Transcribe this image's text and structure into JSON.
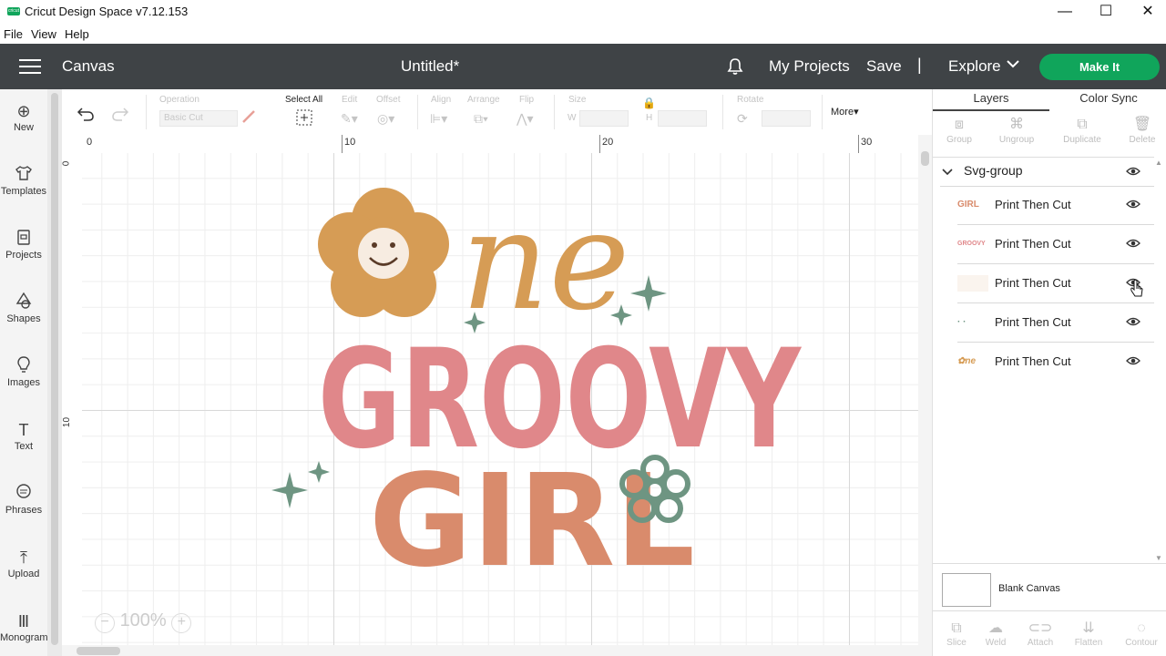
{
  "window": {
    "title": "Cricut Design Space  v7.12.153",
    "logo_text": "cricut",
    "minimize_glyph": "—",
    "maximize_glyph": "☐",
    "close_glyph": "✕"
  },
  "menubar": {
    "items": [
      "File",
      "View",
      "Help"
    ]
  },
  "header": {
    "section": "Canvas",
    "doc_title": "Untitled*",
    "my_projects": "My Projects",
    "save": "Save",
    "separator": "|",
    "explore": "Explore",
    "make_it": "Make It",
    "brand_color": "#10a55b",
    "bar_color": "#3f4346"
  },
  "left_rail": {
    "items": [
      {
        "label": "New",
        "icon": "plus-circle-icon",
        "glyph": "⊕"
      },
      {
        "label": "Templates",
        "icon": "shirt-icon",
        "glyph": "👕"
      },
      {
        "label": "Projects",
        "icon": "clipboard-icon",
        "glyph": "📋"
      },
      {
        "label": "Shapes",
        "icon": "shapes-icon",
        "glyph": "△"
      },
      {
        "label": "Images",
        "icon": "lightbulb-icon",
        "glyph": "💡"
      },
      {
        "label": "Text",
        "icon": "text-icon",
        "glyph": "T"
      },
      {
        "label": "Phrases",
        "icon": "speech-bubble-icon",
        "glyph": "💬"
      },
      {
        "label": "Upload",
        "icon": "upload-icon",
        "glyph": "⤒"
      },
      {
        "label": "Monogram",
        "icon": "monogram-icon",
        "glyph": "Ⅲ"
      }
    ]
  },
  "toolbar": {
    "operation_label": "Operation",
    "operation_value": "Basic Cut",
    "select_all": "Select All",
    "edit": "Edit",
    "offset": "Offset",
    "align": "Align",
    "arrange": "Arrange",
    "flip": "Flip",
    "size": "Size",
    "w_label": "W",
    "h_label": "H",
    "rotate": "Rotate",
    "more": "More"
  },
  "ruler": {
    "top_ticks": [
      "0",
      "10",
      "20",
      "30"
    ],
    "left_ticks": [
      "0",
      "10"
    ]
  },
  "zoom": {
    "value": "100%",
    "minus": "−",
    "plus": "+"
  },
  "canvas_art": {
    "line1": "ne",
    "line2": "GROOVY",
    "line3": "GIRL",
    "colors": {
      "flower": "#d69c55",
      "flower_face": "#f7ece1",
      "groovy": "#e0878a",
      "girl": "#d98b6c",
      "sparkle": "#6e9582"
    }
  },
  "right_panel": {
    "tabs": [
      "Layers",
      "Color Sync"
    ],
    "actions": [
      "Group",
      "Ungroup",
      "Duplicate",
      "Delete"
    ],
    "group_name": "Svg-group",
    "layers": [
      {
        "name": "Print Then Cut",
        "thumb_text": "GIRL",
        "thumb_color": "#d98b6c"
      },
      {
        "name": "Print Then Cut",
        "thumb_text": "GROOVY",
        "thumb_color": "#e0878a"
      },
      {
        "name": "Print Then Cut",
        "thumb_text": "",
        "thumb_color": "#f7ece1"
      },
      {
        "name": "Print Then Cut",
        "thumb_text": "· ·",
        "thumb_color": "#6e9582"
      },
      {
        "name": "Print Then Cut",
        "thumb_text": "✿ne",
        "thumb_color": "#d69c55"
      }
    ],
    "blank_canvas": "Blank Canvas",
    "bottom_actions": [
      "Slice",
      "Weld",
      "Attach",
      "Flatten",
      "Contour"
    ]
  }
}
